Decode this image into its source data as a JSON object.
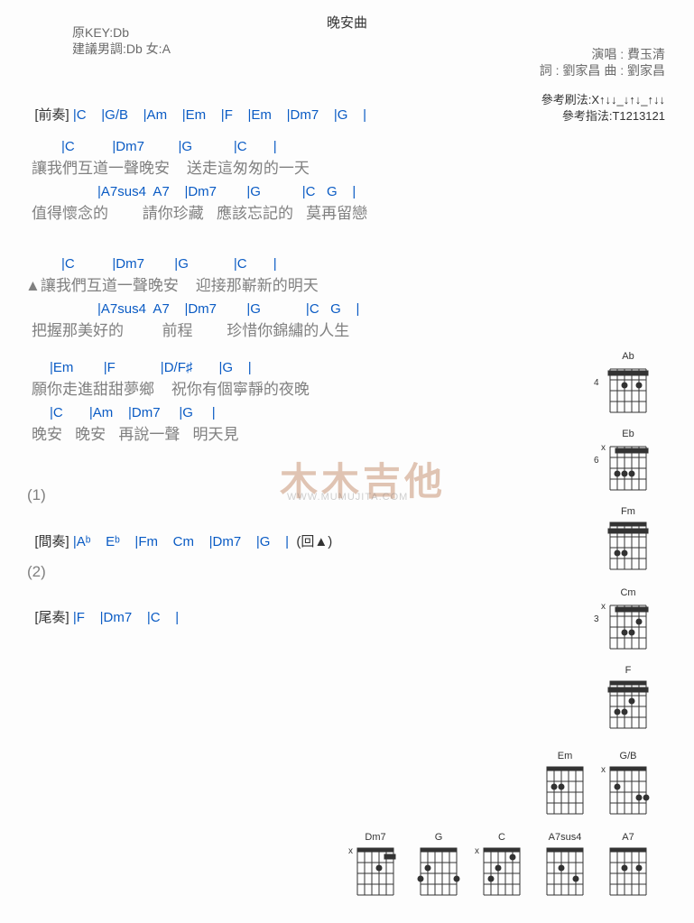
{
  "title": "晚安曲",
  "meta": {
    "key": "原KEY:Db",
    "suggest": "建議男調:Db 女:A",
    "singer_label": "演唱 : ",
    "singer": "費玉清",
    "lyric_label": "詞 : ",
    "lyricist": "劉家昌",
    "compose_label": " 曲 : ",
    "composer": "劉家昌",
    "strum_label": "參考刷法:",
    "strum": "X↑↓↓_↓↑↓_↑↓↓",
    "finger_label": "參考指法:",
    "finger": "T1213121"
  },
  "sections": {
    "intro": "[前奏]",
    "interlude": "[間奏]",
    "outro": "[尾奏]",
    "repeat1": "(1)",
    "repeat2": "(2)",
    "goback": "(回▲)"
  },
  "intro_chords": "|C    |G/B    |Am    |Em    |F    |Em    |Dm7    |G    |",
  "v1": {
    "c1": "|C          |Dm7         |G           |C       |",
    "l1": "讓我們互道一聲晚安    送走這匆匆的一天",
    "c2": "|A7sus4  A7    |Dm7        |G           |C   G    |",
    "l2": "值得懷念的        請你珍藏   應該忘記的   莫再留戀"
  },
  "v2": {
    "c1": "|C          |Dm7        |G            |C       |",
    "l1": "▲讓我們互道一聲晚安    迎接那嶄新的明天",
    "c2": "|A7sus4  A7    |Dm7        |G            |C   G    |",
    "l2": "把握那美好的         前程        珍惜你錦繡的人生"
  },
  "v3": {
    "c1": "|Em        |F            |D/F♯       |G    |",
    "l1": "願你走進甜甜夢鄉    祝你有個寧靜的夜晚",
    "c2": "|C       |Am    |Dm7     |G     |",
    "l2": "晚安   晚安   再說一聲   明天見"
  },
  "interlude_chords": "|Aᵇ    Eᵇ    |Fm    Cm    |Dm7    |G    |",
  "outro_chords": "|F    |Dm7    |C    |",
  "diagrams": {
    "Ab": {
      "name": "Ab",
      "fret": "4"
    },
    "Eb": {
      "name": "Eb",
      "fret": "6",
      "mute": "x"
    },
    "Fm": {
      "name": "Fm",
      "fret": ""
    },
    "Cm": {
      "name": "Cm",
      "fret": "3",
      "mute": "x"
    },
    "F": {
      "name": "F",
      "fret": ""
    },
    "Em": {
      "name": "Em",
      "fret": ""
    },
    "GB": {
      "name": "G/B",
      "fret": "",
      "mute": "x"
    },
    "Dm7": {
      "name": "Dm7",
      "fret": "",
      "mute": "x"
    },
    "G": {
      "name": "G",
      "fret": ""
    },
    "C": {
      "name": "C",
      "fret": "",
      "mute": "x"
    },
    "A7sus4": {
      "name": "A7sus4",
      "fret": ""
    },
    "A7": {
      "name": "A7",
      "fret": ""
    }
  },
  "watermark": {
    "l1": "木木吉他",
    "l2": "WWW.MUMUJITA.COM"
  }
}
